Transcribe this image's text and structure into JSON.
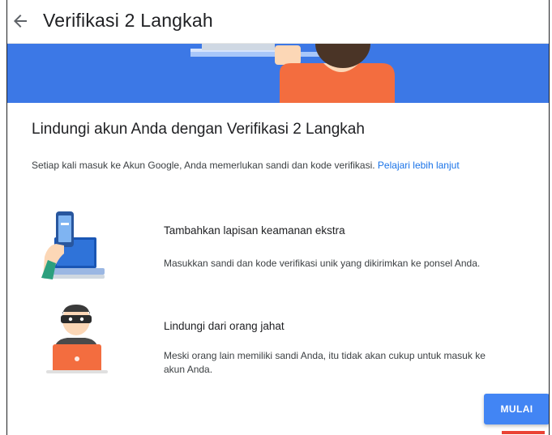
{
  "topbar": {
    "back_icon": "arrow-back-icon",
    "title": "Verifikasi 2 Langkah"
  },
  "hero": {
    "background_color": "#3c78e6",
    "illustration": "person-at-laptop-illustration"
  },
  "main": {
    "heading": "Lindungi akun Anda dengan Verifikasi 2 Langkah",
    "description": "Setiap kali masuk ke Akun Google, Anda memerlukan sandi dan kode verifikasi.",
    "learn_more_link": "Pelajari lebih lanjut",
    "features": [
      {
        "icon": "phone-laptop-icon",
        "title": "Tambahkan lapisan keamanan ekstra",
        "text": "Masukkan sandi dan kode verifikasi unik yang dikirimkan ke ponsel Anda."
      },
      {
        "icon": "masked-thief-icon",
        "title": "Lindungi dari orang jahat",
        "text": "Meski orang lain memiliki sandi Anda, itu tidak akan cukup untuk masuk ke akun Anda."
      }
    ],
    "start_button": "MULAI"
  },
  "colors": {
    "accent_blue": "#4285f4",
    "link_blue": "#1a73e8",
    "hero_blue": "#3c78e6",
    "highlight_red": "#ea4335"
  }
}
